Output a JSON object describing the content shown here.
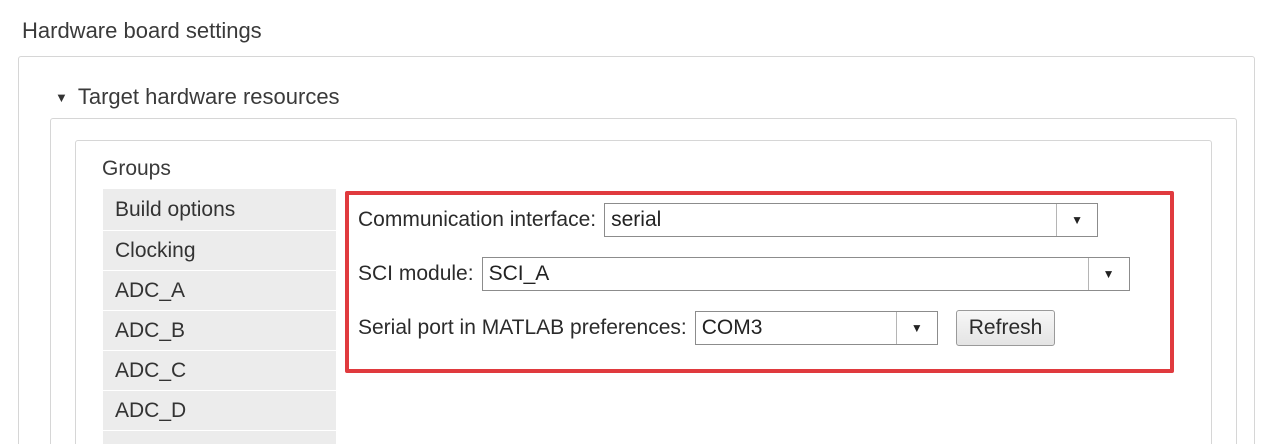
{
  "section": {
    "title": "Hardware board settings"
  },
  "collapsible": {
    "title": "Target hardware resources",
    "caret_icon": "caret-down-icon"
  },
  "groups": {
    "label": "Groups",
    "items": [
      {
        "label": "Build options"
      },
      {
        "label": "Clocking"
      },
      {
        "label": "ADC_A"
      },
      {
        "label": "ADC_B"
      },
      {
        "label": "ADC_C"
      },
      {
        "label": "ADC_D"
      }
    ]
  },
  "settings": {
    "communication_interface": {
      "label": "Communication interface:",
      "value": "serial"
    },
    "sci_module": {
      "label": "SCI module:",
      "value": "SCI_A"
    },
    "serial_port": {
      "label": "Serial port in MATLAB preferences:",
      "value": "COM3",
      "refresh_label": "Refresh"
    }
  },
  "colors": {
    "highlight_border": "#e03a3e",
    "group_list_bg": "#ececec"
  }
}
